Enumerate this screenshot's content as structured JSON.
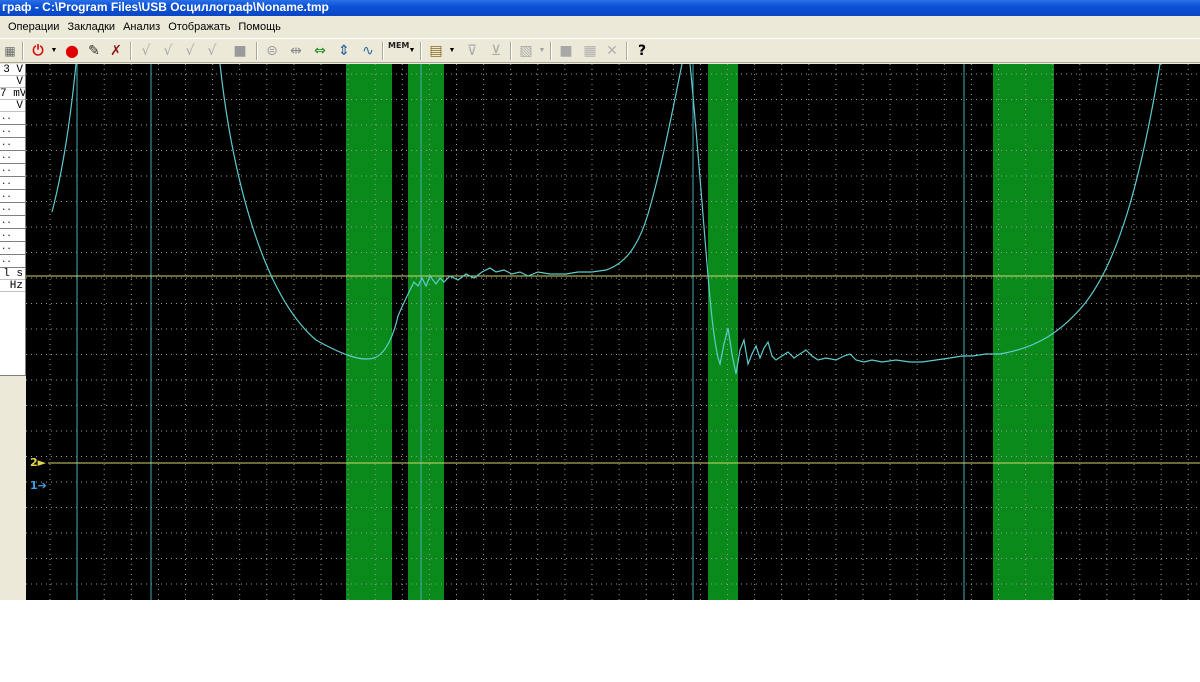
{
  "window": {
    "title": "граф - C:\\Program Files\\USB Осциллограф\\Noname.tmp"
  },
  "menu": {
    "items": [
      {
        "id": "operations",
        "label": "Операции"
      },
      {
        "id": "bookmarks",
        "label": "Закладки"
      },
      {
        "id": "analysis",
        "label": "Анализ"
      },
      {
        "id": "display",
        "label": "Отображать"
      },
      {
        "id": "help",
        "label": "Помощь"
      }
    ]
  },
  "toolbar": {
    "mem_label": "МЕМ",
    "help_icon": "?"
  },
  "left_panel": {
    "rows": [
      "3 V",
      "V",
      "7 mV",
      "V"
    ],
    "bottom_rows": [
      "l s",
      "Hz"
    ]
  },
  "markers": {
    "ch2": "2",
    "ch1": "1"
  },
  "colors": {
    "background": "#000000",
    "grid_dots": "#9a9a9a",
    "highlight": "#0b8a1c",
    "trace": "#5ecbcc",
    "cursor_line": "#46a8b2",
    "level_line": "#d4d46a",
    "marker_ch2": "#e0d84a",
    "marker_ch1": "#3aa0e8"
  }
}
